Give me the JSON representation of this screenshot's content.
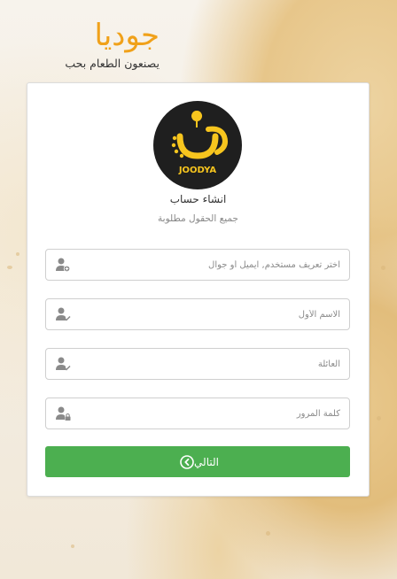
{
  "brand": {
    "title": "جوديا",
    "tagline": "يصنعون الطعام بحب"
  },
  "logo": {
    "text": "JOODYA",
    "accent_color": "#f7c51e"
  },
  "form": {
    "title": "انشاء حساب",
    "subtitle": "جميع الحقول مطلوبة",
    "fields": [
      {
        "placeholder": "اختر تعريف مستخدم, ايميل أو جوال",
        "value": "",
        "icon": "user-add-icon"
      },
      {
        "placeholder": "الاسم الأول",
        "value": "",
        "icon": "user-check-icon"
      },
      {
        "placeholder": "العائلة",
        "value": "",
        "icon": "user-check-icon"
      },
      {
        "placeholder": "كلمة المرور",
        "value": "",
        "icon": "user-lock-icon"
      }
    ],
    "next_button": {
      "label": "التالي",
      "icon": "arrow-circle-icon",
      "color": "#4caf50"
    }
  }
}
